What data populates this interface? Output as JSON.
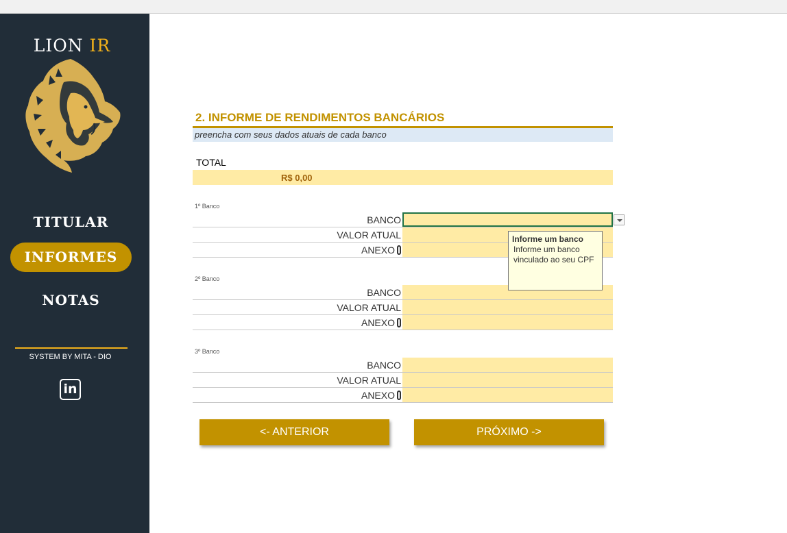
{
  "sidebar": {
    "brand_main": "LION",
    "brand_accent": "IR",
    "logo_icon": "lion-head-icon",
    "nav": [
      {
        "label": "TITULAR",
        "active": false
      },
      {
        "label": "INFORMES",
        "active": true
      },
      {
        "label": "NOTAS",
        "active": false
      }
    ],
    "credit": "SYSTEM BY MITA - DIO",
    "social_icon": "linkedin-icon",
    "social_glyph": "in"
  },
  "main": {
    "title": "2. INFORME DE RENDIMENTOS BANCÁRIOS",
    "subtitle": "preencha com seus dados atuais de cada banco",
    "total_label": "TOTAL",
    "total_value": "R$ 0,00",
    "groups": [
      {
        "label": "1º Banco",
        "rows": [
          {
            "label": "BANCO",
            "value": ""
          },
          {
            "label": "VALOR ATUAL",
            "value": ""
          },
          {
            "label": "ANEXO",
            "value": ""
          }
        ]
      },
      {
        "label": "2º Banco",
        "rows": [
          {
            "label": "BANCO",
            "value": ""
          },
          {
            "label": "VALOR ATUAL",
            "value": ""
          },
          {
            "label": "ANEXO",
            "value": ""
          }
        ]
      },
      {
        "label": "3º Banco",
        "rows": [
          {
            "label": "BANCO",
            "value": ""
          },
          {
            "label": "VALOR ATUAL",
            "value": ""
          },
          {
            "label": "ANEXO",
            "value": ""
          }
        ]
      }
    ],
    "tooltip": {
      "title": "Informe um banco",
      "body": "Informe um banco vinculado ao seu CPF"
    },
    "buttons": {
      "previous": "<- ANTERIOR",
      "next": "PRÓXIMO ->"
    }
  },
  "colors": {
    "sidebar_bg": "#212d38",
    "accent_gold": "#c29200",
    "field_fill": "#ffeba5",
    "subtitle_fill": "#dde9f5"
  }
}
